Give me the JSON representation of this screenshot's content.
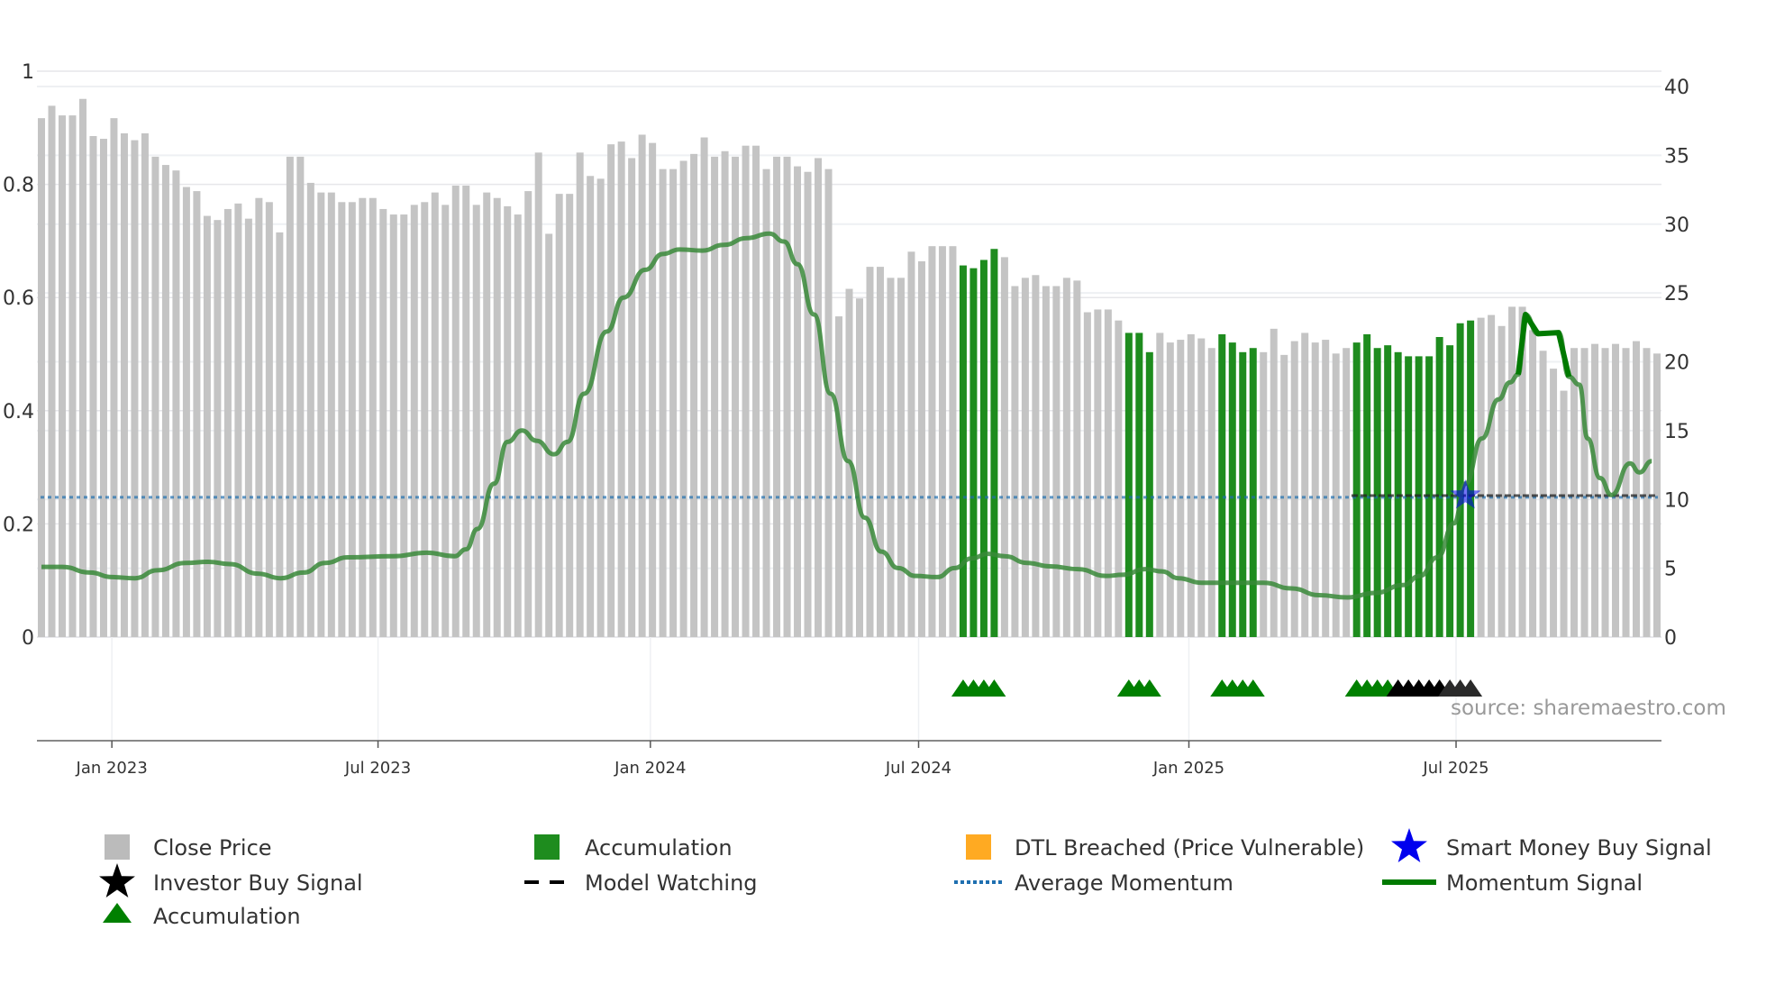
{
  "chart_data": {
    "type": "bar",
    "title": "",
    "x_unit": "week index",
    "left_axis": {
      "range": [
        0,
        1
      ],
      "ticks": [
        "0",
        "0.2",
        "0.4",
        "0.6",
        "0.8",
        "1"
      ],
      "tick_values": [
        0,
        0.2,
        0.4,
        0.6,
        0.8,
        1
      ]
    },
    "right_axis": {
      "range": [
        0,
        40
      ],
      "ticks": [
        "0",
        "5",
        "10",
        "15",
        "20",
        "25",
        "30",
        "35",
        "40"
      ],
      "tick_values": [
        0,
        5,
        10,
        15,
        20,
        25,
        30,
        35,
        40
      ]
    },
    "x_ticks": [
      {
        "label": "Jan 2023",
        "x": 6.8
      },
      {
        "label": "Jul 2023",
        "x": 32.5
      },
      {
        "label": "Jan 2024",
        "x": 58.8
      },
      {
        "label": "Jul 2024",
        "x": 84.7
      },
      {
        "label": "Jan 2025",
        "x": 110.8
      },
      {
        "label": "Jul 2025",
        "x": 136.6
      }
    ],
    "close_price": [
      37.7,
      38.6,
      37.9,
      37.9,
      39.1,
      36.4,
      36.2,
      37.7,
      36.6,
      36.1,
      36.6,
      34.9,
      34.3,
      33.9,
      32.7,
      32.4,
      30.6,
      30.3,
      31.1,
      31.5,
      30.4,
      31.9,
      31.6,
      29.4,
      34.9,
      34.9,
      33.0,
      32.3,
      32.3,
      31.6,
      31.6,
      31.9,
      31.9,
      31.1,
      30.7,
      30.7,
      31.4,
      31.6,
      32.3,
      31.4,
      32.8,
      32.8,
      31.4,
      32.3,
      31.9,
      31.3,
      30.7,
      32.4,
      35.2,
      29.3,
      32.2,
      32.2,
      35.2,
      33.5,
      33.3,
      35.8,
      36.0,
      34.8,
      36.5,
      35.9,
      34.0,
      34.0,
      34.6,
      35.1,
      36.3,
      34.9,
      35.3,
      34.9,
      35.7,
      35.7,
      34.0,
      34.9,
      34.9,
      34.2,
      33.8,
      34.8,
      34.0,
      23.3,
      25.3,
      24.6,
      26.9,
      26.9,
      26.1,
      26.1,
      28.0,
      27.3,
      28.4,
      28.4,
      28.4,
      27.0,
      26.8,
      27.4,
      28.2,
      27.6,
      25.5,
      26.1,
      26.3,
      25.5,
      25.5,
      26.1,
      25.9,
      23.6,
      23.8,
      23.8,
      23.0,
      22.1,
      22.1,
      20.7,
      22.1,
      21.4,
      21.6,
      22.0,
      21.7,
      21.0,
      22.0,
      21.4,
      20.7,
      21.0,
      20.7,
      22.4,
      20.5,
      21.5,
      22.1,
      21.4,
      21.6,
      20.6,
      21.0,
      21.4,
      22.0,
      21.0,
      21.2,
      20.7,
      20.4,
      20.4,
      20.4,
      21.8,
      21.2,
      22.8,
      23.0,
      23.2,
      23.4,
      22.6,
      24.0,
      24.0,
      22.3,
      20.8,
      19.5,
      17.9,
      21.0,
      21.0,
      21.3,
      21.0,
      21.3,
      21.0,
      21.5,
      21.0,
      20.6
    ],
    "accumulation_bars": [
      89,
      90,
      91,
      92,
      105,
      106,
      107,
      114,
      115,
      116,
      117,
      127,
      128,
      129,
      130,
      131,
      132,
      133,
      134,
      135,
      136,
      137,
      138
    ],
    "momentum": [
      [
        0,
        0.124
      ],
      [
        2,
        0.124
      ],
      [
        4.7,
        0.114
      ],
      [
        6.8,
        0.106
      ],
      [
        9,
        0.104
      ],
      [
        11.2,
        0.118
      ],
      [
        13.9,
        0.131
      ],
      [
        16.1,
        0.133
      ],
      [
        18.2,
        0.129
      ],
      [
        20.9,
        0.112
      ],
      [
        23.1,
        0.104
      ],
      [
        25.3,
        0.114
      ],
      [
        27.4,
        0.131
      ],
      [
        29.6,
        0.141
      ],
      [
        34,
        0.143
      ],
      [
        37.2,
        0.149
      ],
      [
        39.9,
        0.143
      ],
      [
        41,
        0.155
      ],
      [
        42.1,
        0.191
      ],
      [
        43.7,
        0.271
      ],
      [
        45,
        0.345
      ],
      [
        46.4,
        0.365
      ],
      [
        47.8,
        0.347
      ],
      [
        49.5,
        0.323
      ],
      [
        50.8,
        0.345
      ],
      [
        52.4,
        0.43
      ],
      [
        54.6,
        0.54
      ],
      [
        56.2,
        0.6
      ],
      [
        58.3,
        0.649
      ],
      [
        60,
        0.677
      ],
      [
        61.6,
        0.685
      ],
      [
        63.8,
        0.683
      ],
      [
        65.9,
        0.693
      ],
      [
        68.1,
        0.705
      ],
      [
        70.3,
        0.713
      ],
      [
        71.7,
        0.699
      ],
      [
        73,
        0.659
      ],
      [
        74.6,
        0.57
      ],
      [
        76.2,
        0.43
      ],
      [
        77.9,
        0.311
      ],
      [
        79.5,
        0.211
      ],
      [
        81.1,
        0.151
      ],
      [
        82.7,
        0.122
      ],
      [
        84.4,
        0.108
      ],
      [
        86.5,
        0.106
      ],
      [
        88.2,
        0.122
      ],
      [
        89.8,
        0.139
      ],
      [
        91.4,
        0.147
      ],
      [
        93,
        0.143
      ],
      [
        95.2,
        0.131
      ],
      [
        97.4,
        0.125
      ],
      [
        100.1,
        0.12
      ],
      [
        102.8,
        0.108
      ],
      [
        104.4,
        0.11
      ],
      [
        106.6,
        0.12
      ],
      [
        108.2,
        0.116
      ],
      [
        109.8,
        0.104
      ],
      [
        112,
        0.096
      ],
      [
        115.3,
        0.096
      ],
      [
        118,
        0.096
      ],
      [
        120.7,
        0.086
      ],
      [
        123.4,
        0.074
      ],
      [
        126.1,
        0.07
      ],
      [
        128.8,
        0.078
      ],
      [
        131.5,
        0.092
      ],
      [
        133.1,
        0.108
      ],
      [
        134.8,
        0.141
      ],
      [
        136.4,
        0.201
      ],
      [
        137.5,
        0.271
      ],
      [
        139.1,
        0.351
      ],
      [
        140.7,
        0.42
      ],
      [
        141.8,
        0.45
      ],
      [
        142.6,
        0.464
      ],
      [
        143.3,
        0.57
      ],
      [
        144.5,
        0.536
      ],
      [
        146.5,
        0.538
      ],
      [
        147.5,
        0.46
      ],
      [
        148.5,
        0.446
      ],
      [
        149.3,
        0.351
      ],
      [
        150.5,
        0.281
      ],
      [
        151.6,
        0.251
      ],
      [
        153.4,
        0.307
      ],
      [
        154.3,
        0.291
      ],
      [
        155.5,
        0.311
      ]
    ],
    "momentum_signal_range": [
      142.6,
      147.5
    ],
    "average_momentum": 0.247,
    "model_watching": {
      "from": 126.5,
      "to": 156,
      "value": 0.25
    },
    "smart_money_buy_signal": {
      "x": 137.5,
      "value": 0.25
    },
    "accumulation_markers": [
      {
        "x": 89,
        "color": "#008000"
      },
      {
        "x": 90,
        "color": "#008000"
      },
      {
        "x": 91,
        "color": "#008000"
      },
      {
        "x": 92,
        "color": "#008000"
      },
      {
        "x": 105,
        "color": "#008000"
      },
      {
        "x": 106,
        "color": "#008000"
      },
      {
        "x": 107,
        "color": "#008000"
      },
      {
        "x": 114,
        "color": "#008000"
      },
      {
        "x": 115,
        "color": "#008000"
      },
      {
        "x": 116,
        "color": "#008000"
      },
      {
        "x": 117,
        "color": "#008000"
      },
      {
        "x": 127,
        "color": "#008000"
      },
      {
        "x": 128,
        "color": "#008000"
      },
      {
        "x": 129,
        "color": "#008000"
      },
      {
        "x": 130,
        "color": "#008000"
      },
      {
        "x": 131,
        "color": "#000000"
      },
      {
        "x": 132,
        "color": "#000000"
      },
      {
        "x": 133,
        "color": "#000000"
      },
      {
        "x": 134,
        "color": "#000000"
      },
      {
        "x": 135,
        "color": "#000000"
      },
      {
        "x": 136,
        "color": "#2a2a2a"
      },
      {
        "x": 137,
        "color": "#2a2a2a"
      },
      {
        "x": 138,
        "color": "#2a2a2a"
      }
    ],
    "colors": {
      "close": "#c4c4c4",
      "accumulation": "#1e8c1e",
      "dtl": "#ffaa22",
      "smart_money": "#0000ee",
      "momentum": "#3a8a3a",
      "momentum_signal": "#007a00",
      "average": "#1f6fb0"
    },
    "source": "source: sharemaestro.com",
    "legend": [
      {
        "label": "Close Price",
        "marker": "square",
        "color": "#bbbbbb"
      },
      {
        "label": "Accumulation",
        "marker": "square",
        "color": "#1e8c1e"
      },
      {
        "label": "DTL Breached (Price Vulnerable)",
        "marker": "square",
        "color": "#ffaa22"
      },
      {
        "label": "Smart Money Buy Signal",
        "marker": "star",
        "color": "#0000ee"
      },
      {
        "label": "Investor Buy Signal",
        "marker": "star",
        "color": "#000000"
      },
      {
        "label": "Model Watching",
        "marker": "dash",
        "color": "#000000"
      },
      {
        "label": "Average Momentum",
        "marker": "dot",
        "color": "#1f6fb0"
      },
      {
        "label": "Momentum Signal",
        "marker": "line",
        "color": "#007a00"
      },
      {
        "label": "Accumulation",
        "marker": "triangle",
        "color": "#008000"
      }
    ]
  }
}
